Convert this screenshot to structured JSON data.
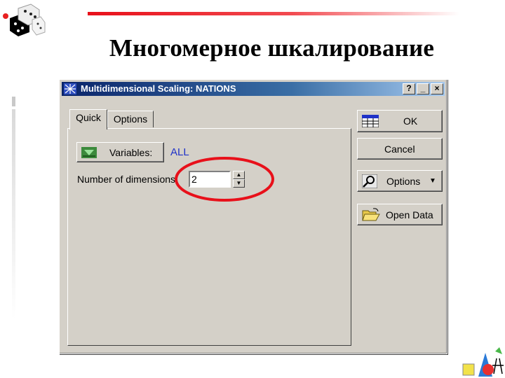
{
  "slide": {
    "title": "Многомерное шкалирование"
  },
  "window": {
    "title": "Multidimensional Scaling: NATIONS",
    "title_buttons": [
      "?",
      "_",
      "×"
    ]
  },
  "tabs": [
    {
      "label": "Quick",
      "active": true
    },
    {
      "label": "Options",
      "active": false
    }
  ],
  "quick": {
    "variables_button": "Variables:",
    "variables_value": "ALL",
    "dimensions_label": "Number of dimensions:",
    "dimensions_value": "2"
  },
  "side_buttons": {
    "ok": "OK",
    "cancel": "Cancel",
    "options": "Options",
    "open_data": "Open Data"
  },
  "colors": {
    "accent_line": "#e8101a",
    "highlight_ellipse": "#e8101a",
    "value_text": "#1f32c8",
    "dialog_bg": "#d4d0c8"
  }
}
